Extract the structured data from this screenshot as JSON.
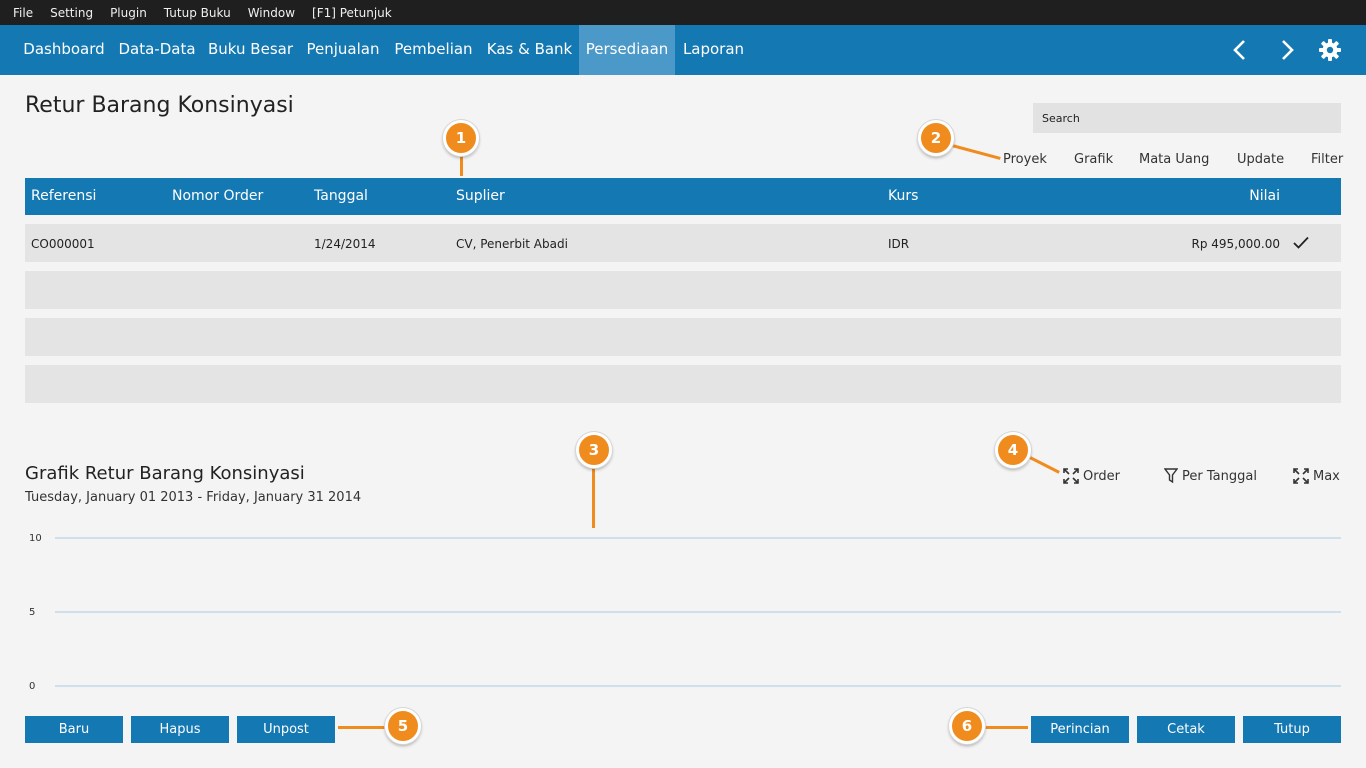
{
  "menubar": {
    "items": [
      "File",
      "Setting",
      "Plugin",
      "Tutup Buku",
      "Window",
      "[F1] Petunjuk"
    ]
  },
  "nav": {
    "tabs": [
      "Dashboard",
      "Data-Data",
      "Buku Besar",
      "Penjualan",
      "Pembelian",
      "Kas & Bank",
      "Persediaan",
      "Laporan"
    ],
    "active": "Persediaan",
    "icons": [
      "chevron-left-icon",
      "chevron-right-icon",
      "gear-icon"
    ]
  },
  "page": {
    "title": "Retur Barang Konsinyasi"
  },
  "search": {
    "placeholder": "Search",
    "value": ""
  },
  "toolbar": {
    "links": [
      "Proyek",
      "Grafik",
      "Mata Uang",
      "Update",
      "Filter"
    ]
  },
  "table": {
    "columns": [
      "Referensi",
      "Nomor Order",
      "Tanggal",
      "Suplier",
      "Kurs",
      "Nilai"
    ],
    "rows": [
      {
        "referensi": "CO000001",
        "nomor_order": "",
        "tanggal": "1/24/2014",
        "suplier": "CV, Penerbit Abadi",
        "kurs": "IDR",
        "nilai": "Rp 495,000.00",
        "posted": true
      }
    ]
  },
  "chart_section": {
    "title": "Grafik Retur Barang Konsinyasi",
    "subtitle": "Tuesday, January 01 2013 - Friday, January 31 2014",
    "tools": [
      "Order",
      "Per Tanggal",
      "Max"
    ]
  },
  "chart_data": {
    "type": "bar",
    "categories": [],
    "series": [],
    "ylim": [
      0,
      10
    ],
    "yticks": [
      "10",
      "5",
      "0"
    ],
    "grid": true
  },
  "buttons": {
    "left": [
      "Baru",
      "Hapus",
      "Unpost"
    ],
    "right": [
      "Perincian",
      "Cetak",
      "Tutup"
    ]
  },
  "callouts": [
    "1",
    "2",
    "3",
    "4",
    "5",
    "6"
  ],
  "colors": {
    "accent": "#1478b2",
    "active_tab": "#4b99c8",
    "callout": "#f08c1e",
    "row_bg": "#e4e4e4",
    "menubar": "#1f1f1f"
  }
}
